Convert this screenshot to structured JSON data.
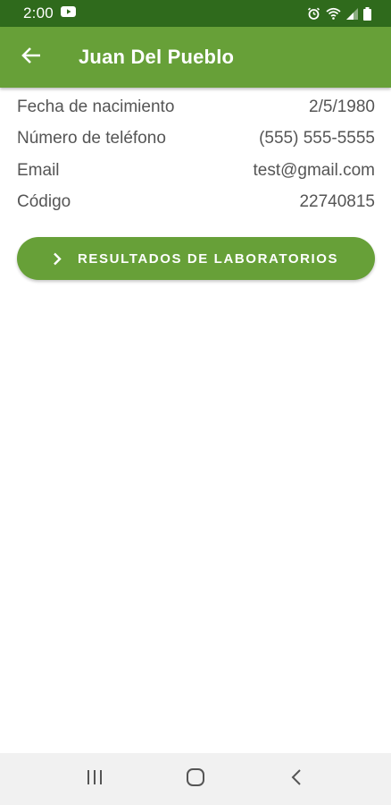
{
  "status_bar": {
    "time": "2:00",
    "background": "#2f6a1c",
    "icons": [
      "youtube-icon",
      "alarm-icon",
      "wifi-icon",
      "signal-icon",
      "battery-icon"
    ]
  },
  "app_bar": {
    "title": "Juan Del Pueblo",
    "background": "#67a038",
    "back_icon": "arrow-left-icon"
  },
  "patient_info": [
    {
      "label": "Fecha de nacimiento",
      "value": "2/5/1980"
    },
    {
      "label": "Número de teléfono",
      "value": "(555) 555-5555"
    },
    {
      "label": "Email",
      "value": "test@gmail.com"
    },
    {
      "label": "Código",
      "value": "22740815"
    }
  ],
  "lab_button": {
    "label": "RESULTADOS DE LABORATORIOS",
    "icon": "chevron-right-icon",
    "color": "#67a038"
  },
  "nav_bar": {
    "buttons": [
      "recent-apps-icon",
      "home-icon",
      "back-nav-icon"
    ]
  }
}
